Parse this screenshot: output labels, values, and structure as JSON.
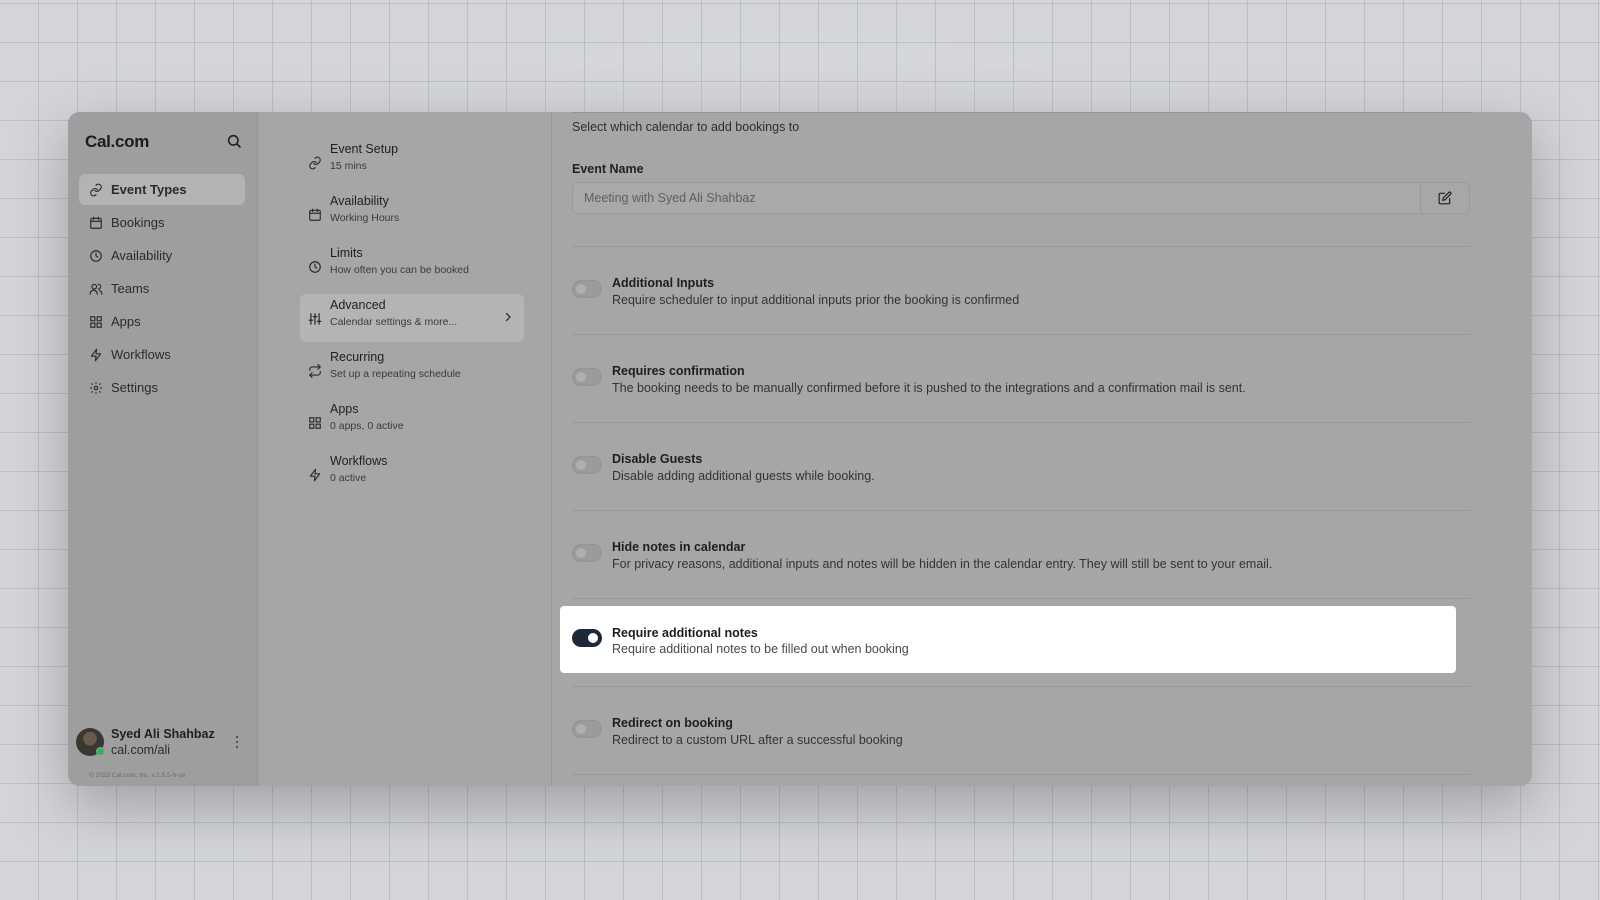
{
  "app": {
    "logo": "Cal.com"
  },
  "sidebar": {
    "items": [
      {
        "label": "Event Types",
        "icon": "link-icon",
        "active": true
      },
      {
        "label": "Bookings",
        "icon": "calendar-icon"
      },
      {
        "label": "Availability",
        "icon": "clock-icon"
      },
      {
        "label": "Teams",
        "icon": "users-icon"
      },
      {
        "label": "Apps",
        "icon": "grid-icon"
      },
      {
        "label": "Workflows",
        "icon": "zap-icon"
      },
      {
        "label": "Settings",
        "icon": "gear-icon"
      }
    ],
    "user": {
      "name": "Syed Ali Shahbaz",
      "link": "cal.com/ali",
      "status_color": "#2fb35d"
    },
    "copyright": "© 2023 Cal.com, Inc. v.2.5.5-h-ce"
  },
  "submenu": {
    "items": [
      {
        "title": "Event Setup",
        "desc": "15 mins",
        "icon": "link-icon"
      },
      {
        "title": "Availability",
        "desc": "Working Hours",
        "icon": "calendar-icon"
      },
      {
        "title": "Limits",
        "desc": "How often you can be booked",
        "icon": "clock-icon"
      },
      {
        "title": "Advanced",
        "desc": "Calendar settings & more...",
        "icon": "sliders-icon",
        "active": true
      },
      {
        "title": "Recurring",
        "desc": "Set up a repeating schedule",
        "icon": "repeat-icon"
      },
      {
        "title": "Apps",
        "desc": "0 apps, 0 active",
        "icon": "grid-icon"
      },
      {
        "title": "Workflows",
        "desc": "0 active",
        "icon": "zap-icon"
      }
    ]
  },
  "main": {
    "intro": "Select which calendar to add bookings to",
    "event_name": {
      "label": "Event Name",
      "placeholder": "Meeting with Syed Ali Shahbaz",
      "value": ""
    },
    "settings": [
      {
        "title": "Additional Inputs",
        "desc": "Require scheduler to input additional inputs prior the booking is confirmed",
        "on": false
      },
      {
        "title": "Requires confirmation",
        "desc": "The booking needs to be manually confirmed before it is pushed to the integrations and a confirmation mail is sent.",
        "on": false
      },
      {
        "title": "Disable Guests",
        "desc": "Disable adding additional guests while booking.",
        "on": false
      },
      {
        "title": "Hide notes in calendar",
        "desc": "For privacy reasons, additional inputs and notes will be hidden in the calendar entry. They will still be sent to your email.",
        "on": false
      },
      {
        "title": "Require additional notes",
        "desc": "Require additional notes to be filled out when booking",
        "on": true
      },
      {
        "title": "Redirect on booking",
        "desc": "Redirect to a custom URL after a successful booking",
        "on": false
      }
    ],
    "toggle_on_color": "#1e2937"
  }
}
